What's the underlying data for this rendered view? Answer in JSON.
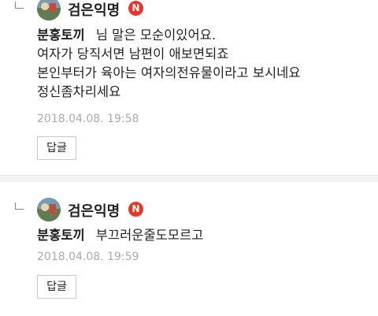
{
  "comments": [
    {
      "nickname": "검은익명",
      "badge": "N",
      "mention": "분홍토끼",
      "lines": [
        "님 말은 모순이있어요.",
        "여자가 당직서면 남편이 애보면되죠",
        "본인부터가 육아는 여자의전유물이라고 보시네요",
        "정신좀차리세요"
      ],
      "date": "2018.04.08. 19:58",
      "reply_label": "답글"
    },
    {
      "nickname": "검은익명",
      "badge": "N",
      "mention": "분홍토끼",
      "lines": [
        "부끄러운줄도모르고"
      ],
      "date": "2018.04.08. 19:59",
      "reply_label": "답글"
    }
  ],
  "colors": {
    "badge": "#e8352a",
    "date": "#aaaaaa",
    "divider": "#f2f2f2"
  }
}
